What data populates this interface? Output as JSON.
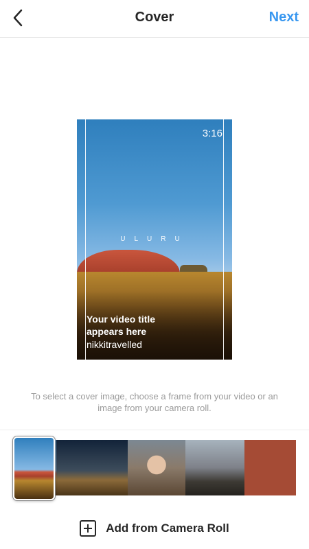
{
  "header": {
    "title": "Cover",
    "next_label": "Next",
    "back_icon": "chevron-left-icon"
  },
  "preview": {
    "timestamp": "3:16",
    "overlay_word": "ULURU",
    "video_title": "Your video title appears here",
    "username": "nikkitravelled"
  },
  "hint": "To select a cover image, choose a frame from your video or an image from your camera roll.",
  "filmstrip": {
    "frames": [
      "frame-1",
      "frame-2",
      "frame-3",
      "frame-4",
      "frame-5"
    ],
    "selected_index": 0
  },
  "add_from_camera_roll": {
    "label": "Add from Camera Roll",
    "icon": "plus-square-icon"
  },
  "colors": {
    "accent": "#3897f0",
    "text": "#262626",
    "hint": "#9a9a9a"
  }
}
